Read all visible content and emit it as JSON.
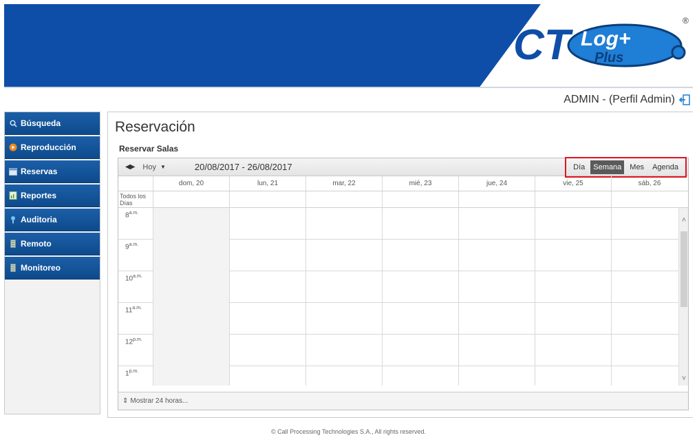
{
  "header": {
    "logo_text": "CTLog+ Plus",
    "brand_color": "#0f4ea8"
  },
  "user": {
    "label": "ADMIN - (Perfil Admin)"
  },
  "sidebar": {
    "items": [
      {
        "label": "Búsqueda",
        "icon": "search-icon"
      },
      {
        "label": "Reproducción",
        "icon": "play-icon"
      },
      {
        "label": "Reservas",
        "icon": "calendar-icon"
      },
      {
        "label": "Reportes",
        "icon": "report-icon"
      },
      {
        "label": "Auditoria",
        "icon": "pin-icon"
      },
      {
        "label": "Remoto",
        "icon": "server-icon"
      },
      {
        "label": "Monitoreo",
        "icon": "server-icon"
      }
    ]
  },
  "main": {
    "title": "Reservación",
    "section": "Reservar Salas"
  },
  "scheduler": {
    "nav": "◀▶",
    "today": "Hoy",
    "range": "20/08/2017 - 26/08/2017",
    "views": [
      "Día",
      "Semana",
      "Mes",
      "Agenda"
    ],
    "active_view": "Semana",
    "days": [
      "dom, 20",
      "lun, 21",
      "mar, 22",
      "mié, 23",
      "jue, 24",
      "vie, 25",
      "sáb, 26"
    ],
    "all_day": "Todos los Días",
    "hours": [
      {
        "h": "8",
        "m": "a.m."
      },
      {
        "h": "9",
        "m": "a.m."
      },
      {
        "h": "10",
        "m": "a.m."
      },
      {
        "h": "11",
        "m": "a.m."
      },
      {
        "h": "12",
        "m": "p.m."
      },
      {
        "h": "1",
        "m": "p.m."
      }
    ],
    "footer": "Mostrar 24 horas..."
  },
  "footer": {
    "copyright": "© Call Processing Technologies S.A., All rights reserved."
  }
}
